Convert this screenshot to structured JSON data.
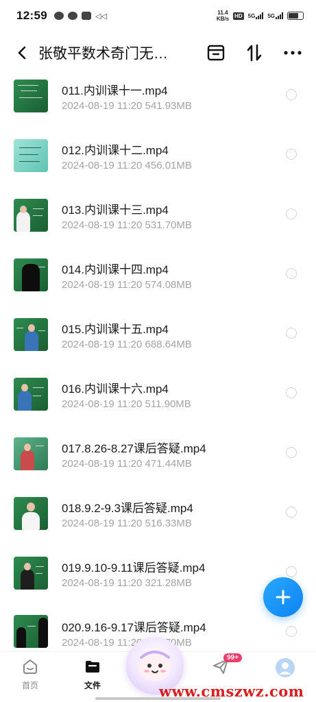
{
  "status_bar": {
    "time": "12:59",
    "speed_value": "11.4",
    "speed_unit": "KB/s",
    "hd_badge": "HD",
    "net1": "5G",
    "net2": "5G"
  },
  "header": {
    "title": "张敬平数术奇门无…",
    "back_icon": "chevron-left-icon",
    "action_icons": [
      "archive-icon",
      "sort-icon",
      "more-icon"
    ]
  },
  "files": [
    {
      "name": "011.内训课十一.mp4",
      "date": "2024-08-19",
      "time": "11:20",
      "size": "541.93MB"
    },
    {
      "name": "012.内训课十二.mp4",
      "date": "2024-08-19",
      "time": "11:20",
      "size": "456.01MB"
    },
    {
      "name": "013.内训课十三.mp4",
      "date": "2024-08-19",
      "time": "11:20",
      "size": "531.70MB"
    },
    {
      "name": "014.内训课十四.mp4",
      "date": "2024-08-19",
      "time": "11:20",
      "size": "574.08MB"
    },
    {
      "name": "015.内训课十五.mp4",
      "date": "2024-08-19",
      "time": "11:20",
      "size": "688.64MB"
    },
    {
      "name": "016.内训课十六.mp4",
      "date": "2024-08-19",
      "time": "11:20",
      "size": "511.90MB"
    },
    {
      "name": "017.8.26-8.27课后答疑.mp4",
      "date": "2024-08-19",
      "time": "11:20",
      "size": "471.44MB"
    },
    {
      "name": "018.9.2-9.3课后答疑.mp4",
      "date": "2024-08-19",
      "time": "11:20",
      "size": "516.33MB"
    },
    {
      "name": "019.9.10-9.11课后答疑.mp4",
      "date": "2024-08-19",
      "time": "11:20",
      "size": "321.28MB"
    },
    {
      "name": "020.9.16-9.17课后答疑.mp4",
      "date": "2024-08-19",
      "time": "11:20",
      "size": "507.70MB"
    }
  ],
  "bottom_nav": {
    "home": "首页",
    "files": "文件",
    "badge": "99+"
  },
  "watermark": "www.cmszwz.com",
  "colors": {
    "accent": "#0d83f2",
    "meta_text": "#a3a3a3",
    "badge": "#f23d6a",
    "watermark": "#d81e1e"
  }
}
